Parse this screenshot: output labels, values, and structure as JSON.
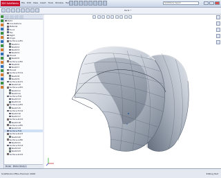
{
  "app": {
    "logo_text": "3DS SolidWorks",
    "menus": [
      "File",
      "Edit",
      "View",
      "Insert",
      "Tools",
      "Window",
      "Help"
    ],
    "search_placeholder": "SolidWorks Search",
    "doc_title": "Part1 *"
  },
  "feature_tree": [
    {
      "label": "Part1",
      "indent": 0,
      "color": "#7a8fb0"
    },
    {
      "label": "Annotations",
      "indent": 1,
      "color": "#d9a441"
    },
    {
      "label": "Material",
      "indent": 1,
      "color": "#8a6e4b"
    },
    {
      "label": "Front",
      "indent": 1,
      "color": "#3d7bd9"
    },
    {
      "label": "Top",
      "indent": 1,
      "color": "#3d7bd9"
    },
    {
      "label": "Right",
      "indent": 1,
      "color": "#3d7bd9"
    },
    {
      "label": "Origin",
      "indent": 1,
      "color": "#c33"
    },
    {
      "label": "Surface-Loft1",
      "indent": 1,
      "color": "#e08a2e"
    },
    {
      "label": "Sketch1",
      "indent": 2,
      "color": "#6c6"
    },
    {
      "label": "Sketch2",
      "indent": 2,
      "color": "#6c6"
    },
    {
      "label": "Sketch3",
      "indent": 2,
      "color": "#6c6"
    },
    {
      "label": "Sketch4",
      "indent": 2,
      "color": "#6c6"
    },
    {
      "label": "Plane1",
      "indent": 1,
      "color": "#3d7bd9"
    },
    {
      "label": "Sketch5",
      "indent": 2,
      "color": "#6c6"
    },
    {
      "label": "Surface-Loft2",
      "indent": 1,
      "color": "#e08a2e"
    },
    {
      "label": "Sketch6",
      "indent": 2,
      "color": "#6c6"
    },
    {
      "label": "Sketch7",
      "indent": 2,
      "color": "#6c6"
    },
    {
      "label": "Plane2",
      "indent": 1,
      "color": "#3d7bd9"
    },
    {
      "label": "Surface-Trim1",
      "indent": 1,
      "color": "#e08a2e"
    },
    {
      "label": "Sketch8",
      "indent": 2,
      "color": "#6c6"
    },
    {
      "label": "Sketch9",
      "indent": 2,
      "color": "#6c6"
    },
    {
      "label": "Surface-Knit1",
      "indent": 1,
      "color": "#e08a2e"
    },
    {
      "label": "Sketch10",
      "indent": 2,
      "color": "#6c6"
    },
    {
      "label": "Surface-Loft3",
      "indent": 1,
      "color": "#e08a2e"
    },
    {
      "label": "Sketch11",
      "indent": 2,
      "color": "#6c6"
    },
    {
      "label": "Sketch12",
      "indent": 2,
      "color": "#6c6"
    },
    {
      "label": "Surface-Fill1",
      "indent": 1,
      "color": "#e08a2e"
    },
    {
      "label": "Sketch13",
      "indent": 2,
      "color": "#6c6"
    },
    {
      "label": "Sketch14",
      "indent": 2,
      "color": "#6c6"
    },
    {
      "label": "Surface-Loft4",
      "indent": 1,
      "color": "#e08a2e"
    },
    {
      "label": "Sketch15",
      "indent": 2,
      "color": "#6c6"
    },
    {
      "label": "Surface-Trim2",
      "indent": 1,
      "color": "#e08a2e"
    },
    {
      "label": "Sketch16",
      "indent": 2,
      "color": "#6c6"
    },
    {
      "label": "Sketch17",
      "indent": 2,
      "color": "#6c6"
    },
    {
      "label": "Surface-Knit2",
      "indent": 1,
      "color": "#e08a2e"
    },
    {
      "label": "Sketch18",
      "indent": 2,
      "color": "#6c6"
    },
    {
      "label": "Surface-Loft5",
      "indent": 1,
      "color": "#e08a2e"
    },
    {
      "label": "Sketch19",
      "indent": 2,
      "color": "#6c6"
    },
    {
      "label": "Surface-Fill2",
      "indent": 1,
      "color": "#e08a2e"
    },
    {
      "label": "Surface-Knit3",
      "indent": 1,
      "color": "#e08a2e"
    },
    {
      "label": "Sketch20",
      "indent": 2,
      "color": "#6c6"
    },
    {
      "label": "Surface-Loft6",
      "indent": 1,
      "color": "#e08a2e"
    },
    {
      "label": "Sketch21",
      "indent": 2,
      "color": "#6c6"
    },
    {
      "label": "Surface-Trim3",
      "indent": 1,
      "color": "#e08a2e"
    },
    {
      "label": "Sketch22",
      "indent": 2,
      "color": "#6c6"
    },
    {
      "label": "Sketch23",
      "indent": 2,
      "color": "#6c6"
    },
    {
      "label": "Surface-Knit4",
      "indent": 1,
      "color": "#e08a2e"
    }
  ],
  "bottom_tabs": [
    "Model",
    "Motion Study 1"
  ],
  "status": {
    "left": "SolidWorks Office Premium 2008",
    "right": "Editing Part"
  },
  "colors": {
    "accent": "#2c5ea8",
    "surface_light": "#e2e6ee",
    "surface_dark": "#7d8796"
  }
}
